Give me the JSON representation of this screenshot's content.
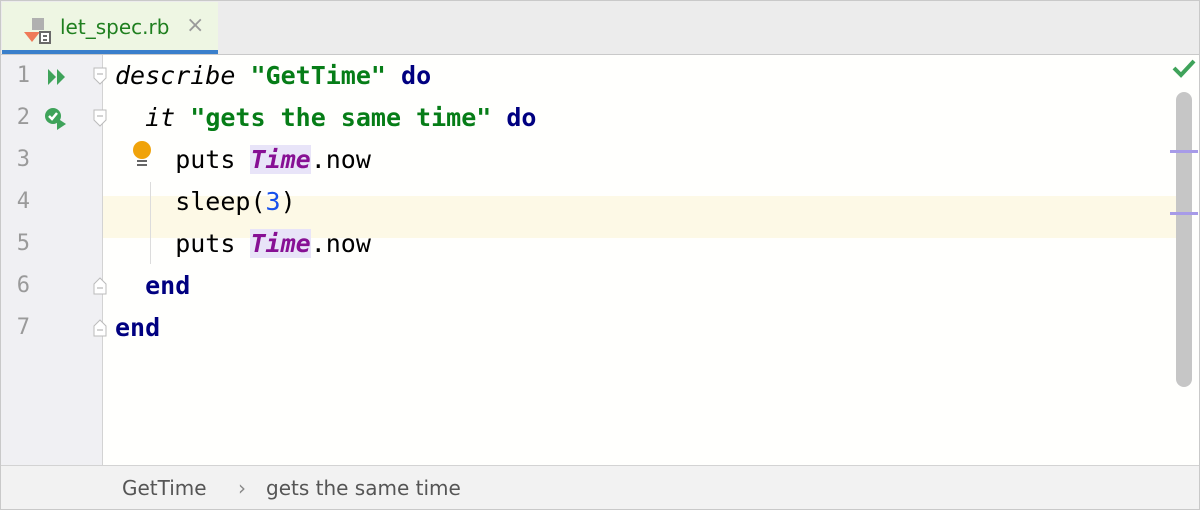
{
  "tab": {
    "filename": "let_spec.rb",
    "close": "×"
  },
  "lines": [
    {
      "n": "1",
      "t": [
        [
          "it",
          "describe"
        ],
        [
          "",
          " "
        ],
        [
          "str",
          "\"GetTime\""
        ],
        [
          "",
          " "
        ],
        [
          "kw",
          "do"
        ]
      ]
    },
    {
      "n": "2",
      "t": [
        [
          "",
          "  "
        ],
        [
          "it",
          "it"
        ],
        [
          "",
          " "
        ],
        [
          "str",
          "\"gets the same time\""
        ],
        [
          "",
          " "
        ],
        [
          "kw",
          "do"
        ]
      ]
    },
    {
      "n": "3",
      "t": [
        [
          "",
          "    puts "
        ],
        [
          "const",
          "Time"
        ],
        [
          "",
          ".now"
        ]
      ]
    },
    {
      "n": "4",
      "t": [
        [
          "",
          "    sleep("
        ],
        [
          "num",
          "3"
        ],
        [
          "",
          ")"
        ]
      ]
    },
    {
      "n": "5",
      "t": [
        [
          "",
          "    puts "
        ],
        [
          "const",
          "Time"
        ],
        [
          "",
          ".now"
        ]
      ]
    },
    {
      "n": "6",
      "t": [
        [
          "",
          "  "
        ],
        [
          "kw",
          "end"
        ]
      ]
    },
    {
      "n": "7",
      "t": [
        [
          "kw",
          "end"
        ]
      ]
    }
  ],
  "breadcrumb": {
    "item1": "GetTime",
    "sep": "›",
    "item2": "gets the same time"
  },
  "colors": {
    "accent": "#3a7fcb",
    "string": "#067d17",
    "keyword": "#000080",
    "constant": "#871094"
  }
}
